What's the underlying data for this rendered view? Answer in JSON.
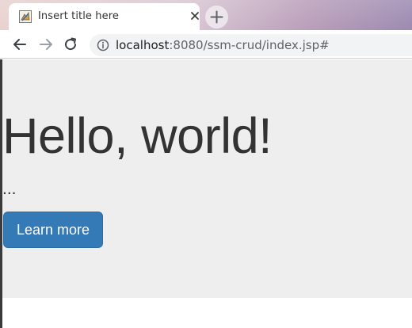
{
  "browser": {
    "tab": {
      "title": "Insert title here",
      "favicon": "page-favicon-icon",
      "close_icon": "close-icon"
    },
    "new_tab_icon": "plus-icon",
    "toolbar": {
      "back_icon": "back-arrow-icon",
      "forward_icon": "forward-arrow-icon",
      "reload_icon": "reload-icon",
      "info_icon": "info-icon",
      "url_host": "localhost",
      "url_rest": ":8080/ssm-crud/index.jsp#"
    }
  },
  "page": {
    "heading": "Hello, world!",
    "text": "...",
    "button_label": "Learn more"
  },
  "colors": {
    "jumbotron_bg": "#eeeeee",
    "primary_button": "#337ab7",
    "heading_text": "#333333"
  }
}
